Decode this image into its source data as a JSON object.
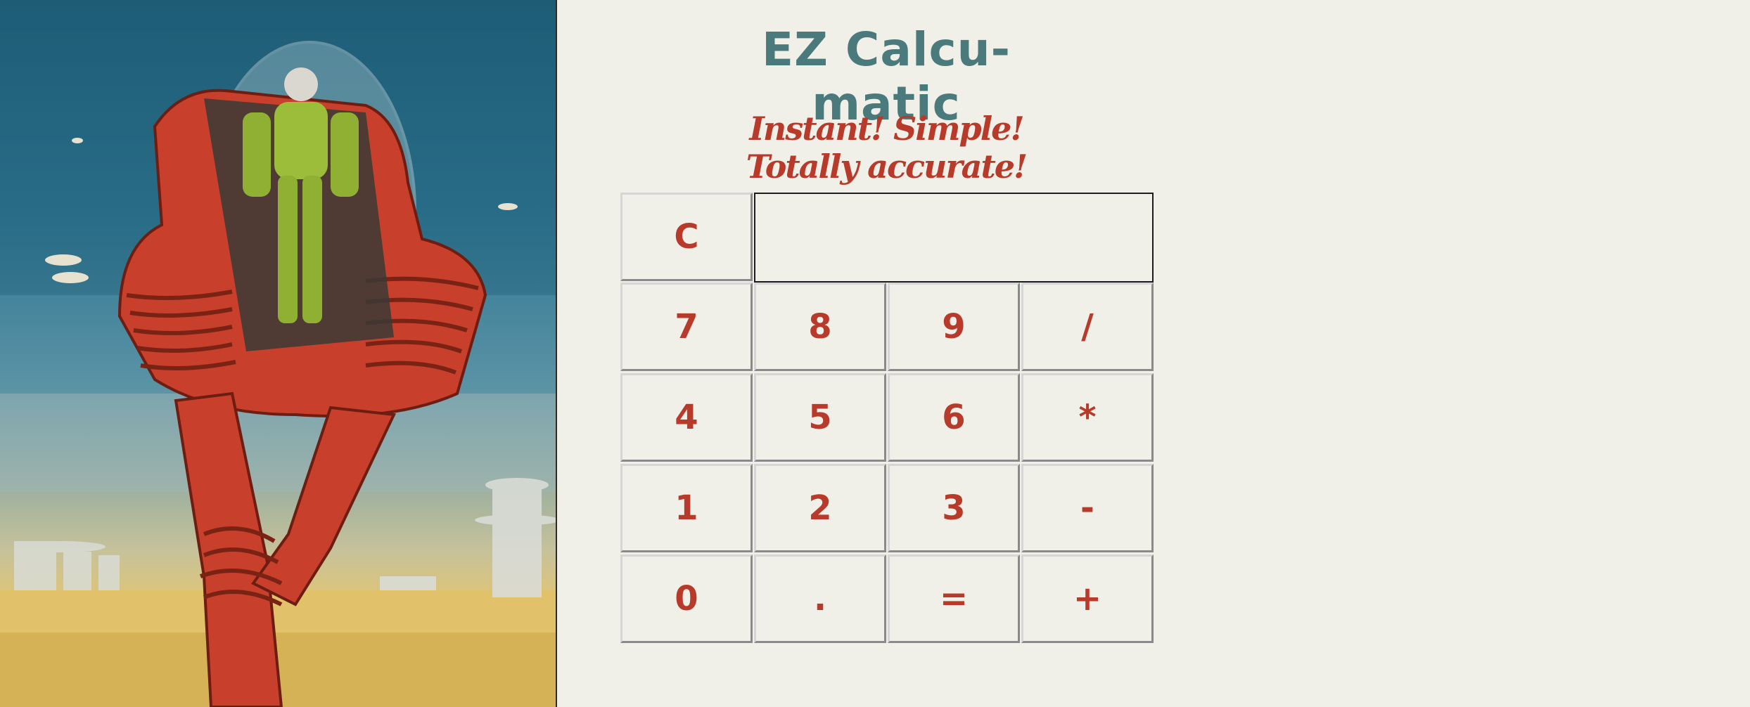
{
  "header": {
    "title": "EZ Calcu-matic",
    "tagline": "Instant! Simple! Totally accurate!"
  },
  "calculator": {
    "display_value": "",
    "clear_label": "C",
    "rows": [
      [
        "7",
        "8",
        "9",
        "/"
      ],
      [
        "4",
        "5",
        "6",
        "*"
      ],
      [
        "1",
        "2",
        "3",
        "-"
      ],
      [
        "0",
        ".",
        "=",
        "+"
      ]
    ]
  },
  "colors": {
    "background": "#f1f0e8",
    "title": "#4a7a7c",
    "accent": "#b83a2a"
  },
  "illustration": {
    "subject": "retro-robot-walker-illustration"
  }
}
